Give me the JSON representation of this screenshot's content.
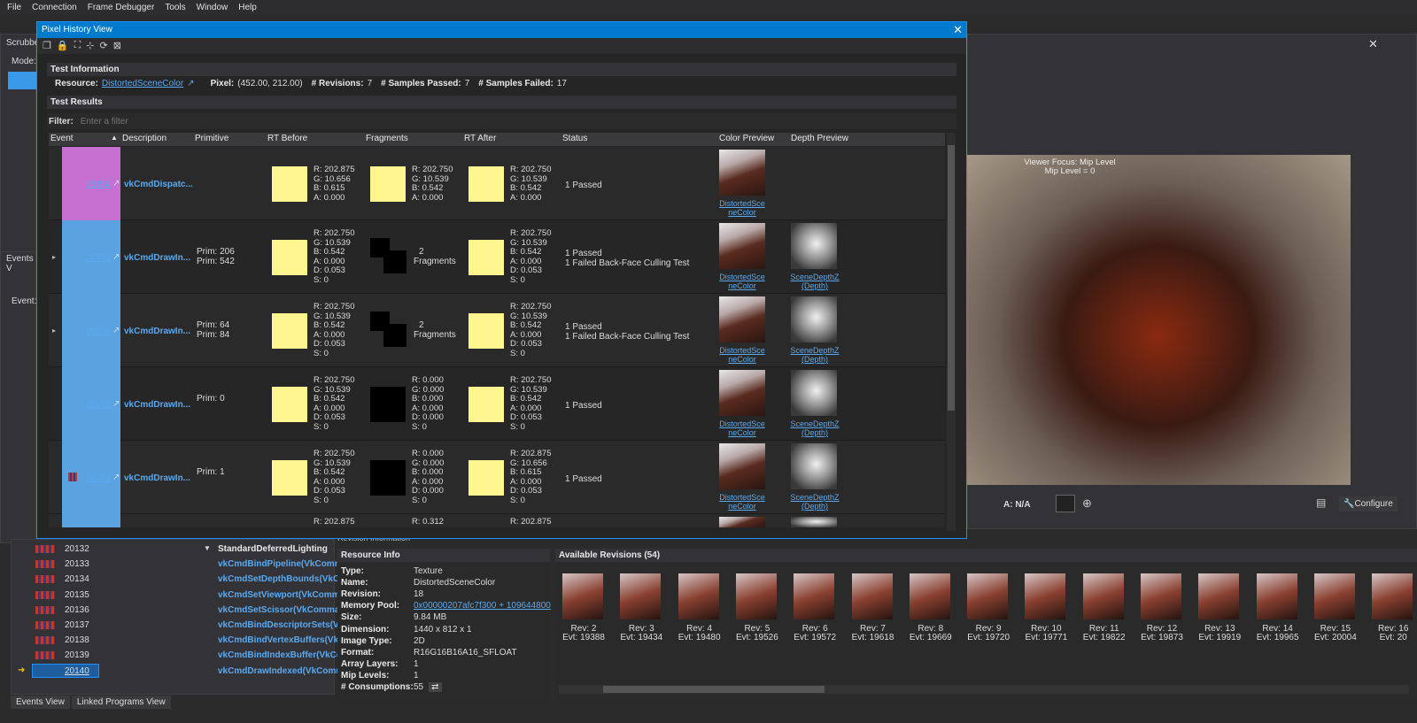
{
  "menu": [
    "File",
    "Connection",
    "Frame Debugger",
    "Tools",
    "Window",
    "Help"
  ],
  "left_panel": {
    "scrubber": "Scrubbe",
    "mode": "Mode:",
    "events_v": "Events V",
    "events_label": "Event:"
  },
  "dialog": {
    "title": "Pixel History View",
    "close": "✕",
    "test_info_header": "Test Information",
    "resource_label": "Resource:",
    "resource_value": "DistortedSceneColor",
    "pixel_label": "Pixel:",
    "pixel_value": "(452.00, 212.00)",
    "revisions_label": "# Revisions:",
    "revisions_value": "7",
    "passed_label": "# Samples Passed:",
    "passed_value": "7",
    "failed_label": "# Samples Failed:",
    "failed_value": "17",
    "test_results_header": "Test Results",
    "filter_label": "Filter:",
    "filter_placeholder": "Enter a filter",
    "columns": [
      "Event",
      "Description",
      "Primitive",
      "RT Before",
      "Fragments",
      "RT After",
      "Status",
      "Color Preview",
      "Depth Preview"
    ],
    "rows": [
      {
        "event": "18654",
        "desc": "vkCmdDispatc...",
        "prim1": "",
        "prim2": "",
        "before": {
          "r": "R: 202.875",
          "g": "G: 10.656",
          "b": "B: 0.615",
          "a": "A: 0.000",
          "d": "",
          "s": ""
        },
        "frag_label1": "",
        "frag_label2": "",
        "frag": {
          "r": "R: 202.750",
          "g": "G: 10.539",
          "b": "B: 0.542",
          "a": "A: 0.000",
          "d": "",
          "s": ""
        },
        "after": {
          "r": "R: 202.750",
          "g": "G: 10.539",
          "b": "B: 0.542",
          "a": "A: 0.000",
          "d": "",
          "s": ""
        },
        "status1": "1 Passed",
        "status2": "",
        "color_link": "DistortedSce neColor",
        "depth_link": ""
      },
      {
        "event": "20473",
        "desc": "vkCmdDrawIn...",
        "prim1": "Prim: 206",
        "prim2": "Prim: 542",
        "before": {
          "r": "R: 202.750",
          "g": "G: 10.539",
          "b": "B: 0.542",
          "a": "A: 0.000",
          "d": "D: 0.053",
          "s": "S: 0"
        },
        "frag_label1": "2",
        "frag_label2": "Fragments",
        "frag": {
          "r": "",
          "g": "",
          "b": "",
          "a": "",
          "d": "",
          "s": ""
        },
        "after": {
          "r": "R: 202.750",
          "g": "G: 10.539",
          "b": "B: 0.542",
          "a": "A: 0.000",
          "d": "D: 0.053",
          "s": "S: 0"
        },
        "status1": "1 Passed",
        "status2": "1 Failed Back-Face Culling Test",
        "color_link": "DistortedSce neColor",
        "depth_link": "SceneDepthZ (Depth)"
      },
      {
        "event": "20536",
        "desc": "vkCmdDrawIn...",
        "prim1": "Prim: 64",
        "prim2": "Prim: 84",
        "before": {
          "r": "R: 202.750",
          "g": "G: 10.539",
          "b": "B: 0.542",
          "a": "A: 0.000",
          "d": "D: 0.053",
          "s": "S: 0"
        },
        "frag_label1": "2",
        "frag_label2": "Fragments",
        "frag": {
          "r": "",
          "g": "",
          "b": "",
          "a": "",
          "d": "",
          "s": ""
        },
        "after": {
          "r": "R: 202.750",
          "g": "G: 10.539",
          "b": "B: 0.542",
          "a": "A: 0.000",
          "d": "D: 0.053",
          "s": "S: 0"
        },
        "status1": "1 Passed",
        "status2": "1 Failed Back-Face Culling Test",
        "color_link": "DistortedSce neColor",
        "depth_link": "SceneDepthZ (Depth)"
      },
      {
        "event": "20655",
        "desc": "vkCmdDrawIn...",
        "prim1": "Prim: 0",
        "prim2": "",
        "before": {
          "r": "R: 202.750",
          "g": "G: 10.539",
          "b": "B: 0.542",
          "a": "A: 0.000",
          "d": "D: 0.053",
          "s": "S: 0"
        },
        "frag_label1": "",
        "frag_label2": "",
        "frag": {
          "r": "R: 0.000",
          "g": "G: 0.000",
          "b": "B: 0.000",
          "a": "A: 0.000",
          "d": "D: 0.000",
          "s": "S: 0"
        },
        "after": {
          "r": "R: 202.750",
          "g": "G: 10.539",
          "b": "B: 0.542",
          "a": "A: 0.000",
          "d": "D: 0.053",
          "s": "S: 0"
        },
        "status1": "1 Passed",
        "status2": "",
        "color_link": "DistortedSce neColor",
        "depth_link": "SceneDepthZ (Depth)"
      },
      {
        "event": "20704",
        "desc": "vkCmdDrawIn...",
        "prim1": "Prim: 1",
        "prim2": "",
        "before": {
          "r": "R: 202.750",
          "g": "G: 10.539",
          "b": "B: 0.542",
          "a": "A: 0.000",
          "d": "D: 0.053",
          "s": "S: 0"
        },
        "frag_label1": "",
        "frag_label2": "",
        "frag": {
          "r": "R: 0.000",
          "g": "G: 0.000",
          "b": "B: 0.000",
          "a": "A: 0.000",
          "d": "D: 0.000",
          "s": "S: 0"
        },
        "after": {
          "r": "R: 202.875",
          "g": "G: 10.656",
          "b": "B: 0.615",
          "a": "A: 0.000",
          "d": "D: 0.053",
          "s": "S: 0"
        },
        "status1": "1 Passed",
        "status2": "",
        "color_link": "DistortedSce neColor",
        "depth_link": "SceneDepthZ (Depth)"
      }
    ],
    "partial_row": {
      "before": "R: 202.875",
      "frag": "R: 0.312",
      "after": "R: 202.875"
    }
  },
  "viewer": {
    "focus1": "Viewer Focus: Mip Level",
    "focus2": "Mip Level = 0",
    "alpha": "A: N/A",
    "configure": "Configure"
  },
  "events": [
    {
      "num": "20132",
      "name": "StandardDeferredLighting"
    },
    {
      "num": "20133",
      "name": "vkCmdBindPipeline(VkComm"
    },
    {
      "num": "20134",
      "name": "vkCmdSetDepthBounds(VkCo"
    },
    {
      "num": "20135",
      "name": "vkCmdSetViewport(VkComm"
    },
    {
      "num": "20136",
      "name": "vkCmdSetScissor(VkComman"
    },
    {
      "num": "20137",
      "name": "vkCmdBindDescriptorSets(V"
    },
    {
      "num": "20138",
      "name": "vkCmdBindVertexBuffers(Vk"
    },
    {
      "num": "20139",
      "name": "vkCmdBindIndexBuffer(VkCo"
    },
    {
      "num": "20140",
      "name": "vkCmdDrawIndexed(VkComm"
    }
  ],
  "revision_info_header": "Revision Information",
  "resource_info": {
    "header": "Resource Info",
    "rows": [
      {
        "k": "Type:",
        "v": "Texture"
      },
      {
        "k": "Name:",
        "v": "DistortedSceneColor"
      },
      {
        "k": "Revision:",
        "v": "18"
      },
      {
        "k": "Memory Pool:",
        "v": "0x00000207afc7f300 + 109644800"
      },
      {
        "k": "Size:",
        "v": "9.84 MB"
      },
      {
        "k": "Dimension:",
        "v": "1440 x 812 x 1"
      },
      {
        "k": "Image Type:",
        "v": "2D"
      },
      {
        "k": "Format:",
        "v": "R16G16B16A16_SFLOAT"
      },
      {
        "k": "Array Layers:",
        "v": "1"
      },
      {
        "k": "Mip Levels:",
        "v": "1"
      },
      {
        "k": "# Consumptions:",
        "v": "55"
      }
    ]
  },
  "revisions": {
    "header": "Available Revisions (54)",
    "items": [
      {
        "rev": "Rev: 2",
        "evt": "Evt: 19388"
      },
      {
        "rev": "Rev: 3",
        "evt": "Evt: 19434"
      },
      {
        "rev": "Rev: 4",
        "evt": "Evt: 19480"
      },
      {
        "rev": "Rev: 5",
        "evt": "Evt: 19526"
      },
      {
        "rev": "Rev: 6",
        "evt": "Evt: 19572"
      },
      {
        "rev": "Rev: 7",
        "evt": "Evt: 19618"
      },
      {
        "rev": "Rev: 8",
        "evt": "Evt: 19669"
      },
      {
        "rev": "Rev: 9",
        "evt": "Evt: 19720"
      },
      {
        "rev": "Rev: 10",
        "evt": "Evt: 19771"
      },
      {
        "rev": "Rev: 11",
        "evt": "Evt: 19822"
      },
      {
        "rev": "Rev: 12",
        "evt": "Evt: 19873"
      },
      {
        "rev": "Rev: 13",
        "evt": "Evt: 19919"
      },
      {
        "rev": "Rev: 14",
        "evt": "Evt: 19965"
      },
      {
        "rev": "Rev: 15",
        "evt": "Evt: 20004"
      },
      {
        "rev": "Rev: 16",
        "evt": "Evt: 20"
      }
    ]
  },
  "bottom_tabs": [
    "Events View",
    "Linked Programs View"
  ],
  "colors": {
    "accent": "#007acc",
    "link": "#5aa9f0",
    "event_purple": "#c86fd2",
    "event_blue": "#5aa2e0",
    "swatch": "#fff68f"
  }
}
